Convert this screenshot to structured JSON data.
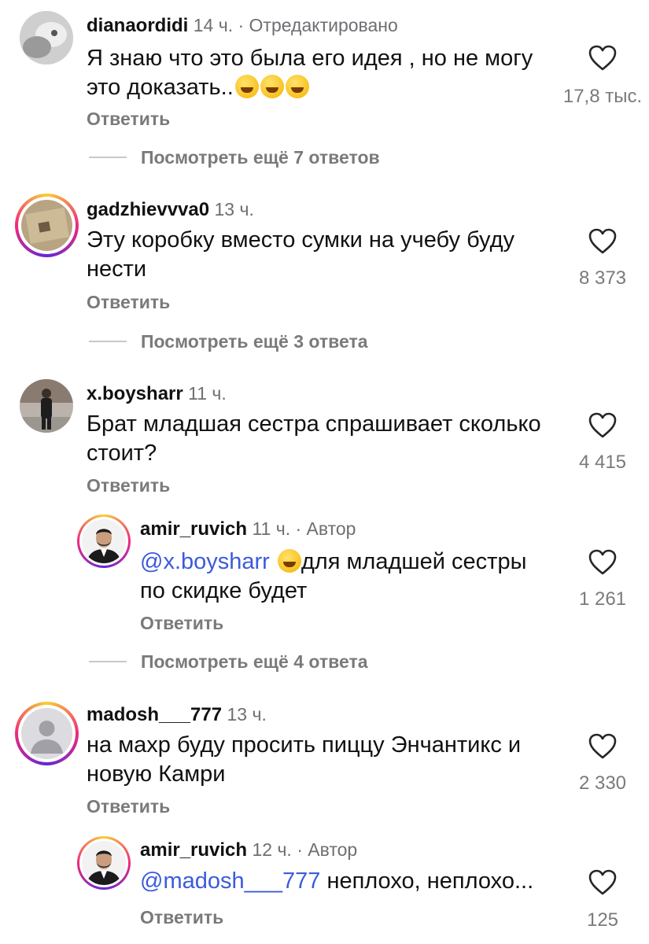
{
  "comments": [
    {
      "username": "dianaordidi",
      "time": "14 ч.",
      "suffix": "· Отредактировано",
      "text": "Я знаю что это была его идея , но не могу это доказать..",
      "emoji_count": 3,
      "reply_label": "Ответить",
      "likes": "17,8 тыс.",
      "more": "Посмотреть ещё 7 ответов"
    },
    {
      "username": "gadzhievvva0",
      "time": "13 ч.",
      "text": "Эту коробку вместо сумки на учебу буду нести",
      "reply_label": "Ответить",
      "likes": "8 373",
      "more": "Посмотреть ещё 3 ответа"
    },
    {
      "username": "x.boysharr",
      "time": "11 ч.",
      "text": "Брат младшая сестра спрашивает сколько стоит?",
      "reply_label": "Ответить",
      "likes": "4 415"
    },
    {
      "username": "amir_ruvich",
      "time": "11 ч.",
      "suffix": "· Автор",
      "mention": "@x.boysharr",
      "text": "для младшей сестры по скидке будет",
      "reply_label": "Ответить",
      "likes": "1 261",
      "more": "Посмотреть ещё 4 ответа"
    },
    {
      "username": "madosh___777",
      "time": "13 ч.",
      "text": "на махр буду просить пиццу Энчантикс и новую Камри",
      "reply_label": "Ответить",
      "likes": "2 330"
    },
    {
      "username": "amir_ruvich",
      "time": "12 ч.",
      "suffix": "· Автор",
      "mention": "@madosh___777",
      "text": "неплохо, неплохо...",
      "reply_label": "Ответить",
      "likes": "125"
    }
  ],
  "icons": {
    "like": "heart-outline-icon",
    "default_avatar": "person-silhouette-icon"
  },
  "colors": {
    "mention": "#3b5bdb",
    "secondary_text": "#7a7a7a",
    "story_ring": "#ee2a7b"
  }
}
